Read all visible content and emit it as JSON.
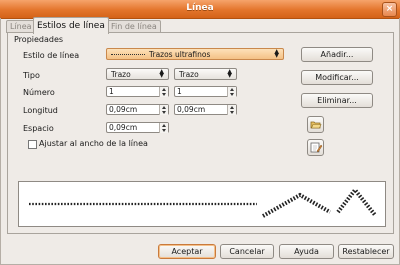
{
  "window": {
    "title": "Línea"
  },
  "tabs": [
    {
      "label": "Línea",
      "active": false
    },
    {
      "label": "Estilos de línea",
      "active": true
    },
    {
      "label": "Fin de línea",
      "active": false
    }
  ],
  "section": {
    "title": "Propiedades"
  },
  "line_style": {
    "label": "Estilo de línea",
    "value": "Trazos ultrafinos"
  },
  "tipo": {
    "label": "Tipo",
    "value1": "Trazo",
    "value2": "Trazo"
  },
  "numero": {
    "label": "Número",
    "value1": "1",
    "value2": "1"
  },
  "longitud": {
    "label": "Longitud",
    "value1": "0,09cm",
    "value2": "0,09cm"
  },
  "espacio": {
    "label": "Espacio",
    "value": "0,09cm"
  },
  "fit_checkbox": {
    "label": "Ajustar al ancho de la línea",
    "checked": false
  },
  "side_buttons": {
    "add": "Añadir...",
    "modify": "Modificar...",
    "delete": "Eliminar..."
  },
  "footer": {
    "accept": "Aceptar",
    "cancel": "Cancelar",
    "help": "Ayuda",
    "reset": "Restablecer"
  },
  "colors": {
    "titlebar": "#e3752c",
    "focus": "#f4c186"
  }
}
